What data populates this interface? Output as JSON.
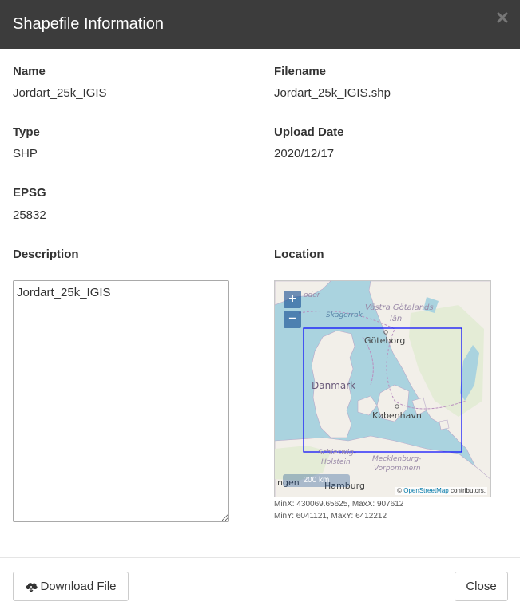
{
  "modal": {
    "title": "Shapefile Information",
    "close_icon": "times-icon"
  },
  "fields": {
    "name": {
      "label": "Name",
      "value": "Jordart_25k_IGIS"
    },
    "filename": {
      "label": "Filename",
      "value": "Jordart_25k_IGIS.shp"
    },
    "type": {
      "label": "Type",
      "value": "SHP"
    },
    "upload_date": {
      "label": "Upload Date",
      "value": "2020/12/17"
    },
    "epsg": {
      "label": "EPSG",
      "value": "25832"
    },
    "description": {
      "label": "Description",
      "value": "Jordart_25k_IGIS"
    },
    "location": {
      "label": "Location"
    }
  },
  "map": {
    "zoom_in": "+",
    "zoom_out": "−",
    "scale": "200 km",
    "attribution_prefix": "©",
    "attribution_link": "OpenStreetMap",
    "attribution_suffix": "contributors.",
    "labels": {
      "skagerrak": "Skagerrak",
      "vastra": "Västra Götalands",
      "lan": "län",
      "goteborg": "Göteborg",
      "danmark": "Danmark",
      "kobenhavn": "København",
      "schleswig": "Schleswig-",
      "holstein": "Holstein",
      "mecklenburg": "Mecklenburg-",
      "vorpommern": "Vorpommern",
      "hamburg": "Hamburg",
      "ingen": "ingen",
      "oder": "oder"
    },
    "extent_color": "#0000ff",
    "water_color": "#aad3df",
    "land_color": "#f2efe9"
  },
  "extent": {
    "line1": "MinX: 430069.65625, MaxX: 907612",
    "line2": "MinY: 6041121, MaxY: 6412212"
  },
  "footer": {
    "download_label": "Download File",
    "download_icon": "cloud-download-icon",
    "close_label": "Close"
  }
}
